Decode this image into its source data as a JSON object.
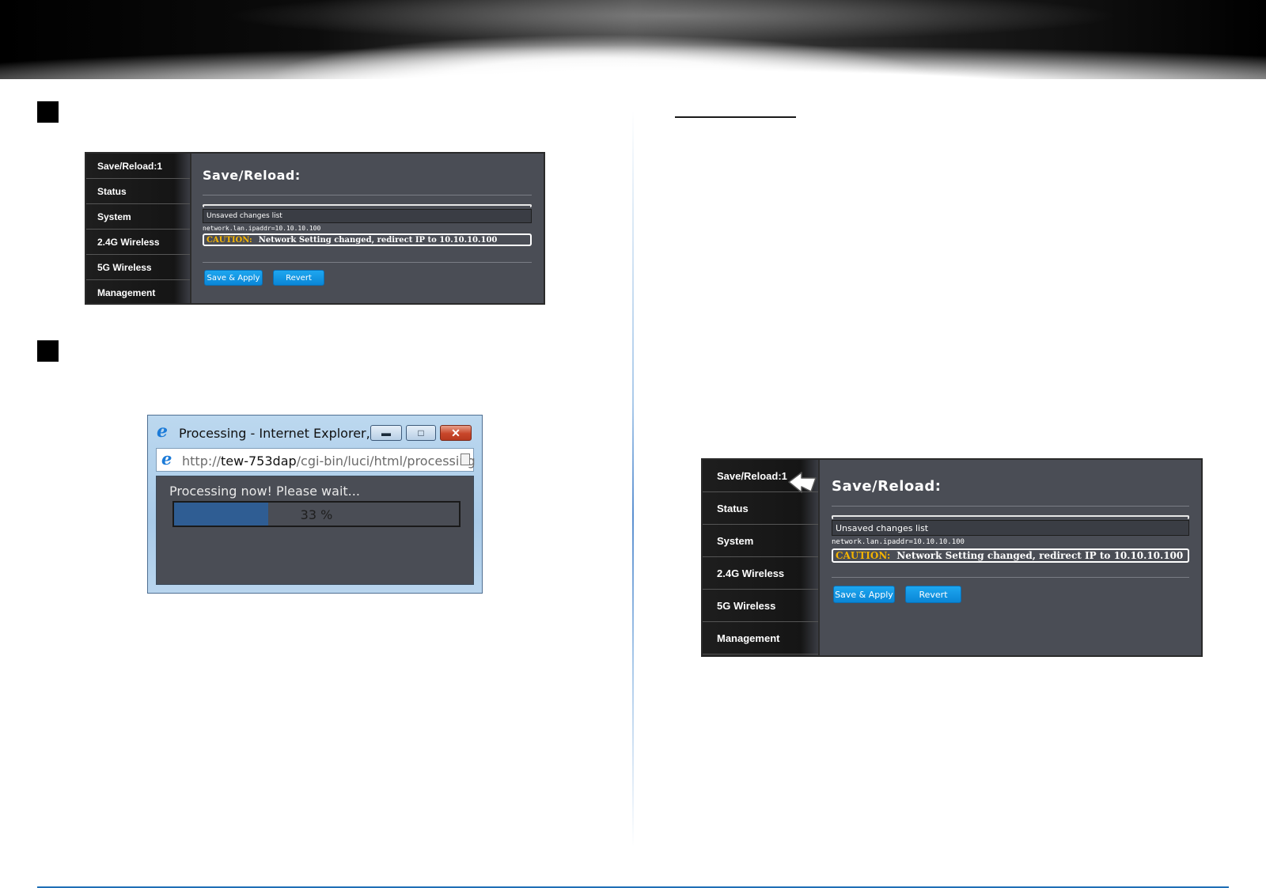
{
  "router_ui": {
    "nav_items": [
      "Save/Reload:1",
      "Status",
      "System",
      "2.4G Wireless",
      "5G Wireless",
      "Management"
    ],
    "page_title": "Save/Reload:",
    "unsaved_header": "Unsaved changes list",
    "config_line": "network.lan.ipaddr=10.10.10.100",
    "caution_label": "CAUTION:",
    "caution_text": "Network Setting changed, redirect IP to  10.10.10.100",
    "save_apply_label": "Save & Apply",
    "revert_label": "Revert"
  },
  "ie_window": {
    "title": "Processing - Internet Explorer, e...",
    "url_prefix": "http://",
    "url_host": "tew-753dap",
    "url_path": "/cgi-bin/luci/html/processing",
    "message": "Processing now! Please wait...",
    "progress_text": "33 %",
    "progress_fraction": 0.33
  },
  "colors": {
    "button_blue": "#0a86d6",
    "caution": "#f5b400",
    "panel_bg": "#4a4d55",
    "divider_blue": "#1f6fb6"
  },
  "icons": {
    "ie_logo": "internet-explorer-icon",
    "minimize": "minimize-icon",
    "restore": "restore-icon",
    "close": "close-icon",
    "page": "page-icon",
    "pointer": "pointer-arrow-icon"
  }
}
